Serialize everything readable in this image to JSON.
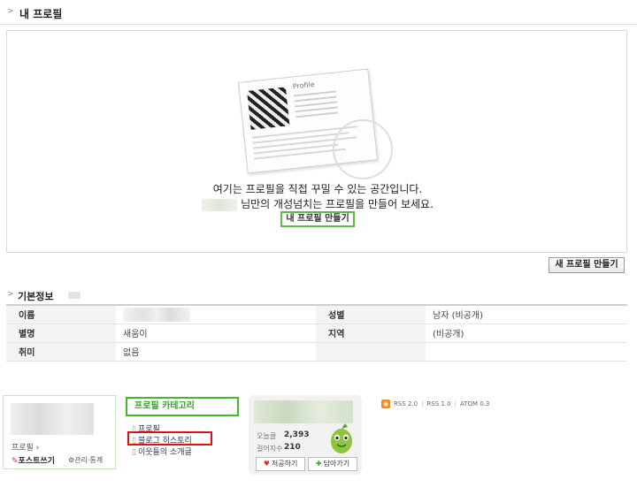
{
  "header": {
    "title": "내 프로필"
  },
  "profile_area": {
    "card_title": "Profile",
    "message_line1": "여기는 프로필을 직접 꾸밀 수 있는 공간입니다.",
    "message_line2": "님만의 개성넘치는 프로필을 만들어 보세요.",
    "make_button": "내 프로필 만들기"
  },
  "new_profile_button": "새 프로필 만들기",
  "basic_info": {
    "title": "기본정보",
    "rows": [
      {
        "label1": "이름",
        "value1": "",
        "label2": "성별",
        "value2": "남자 (비공개)"
      },
      {
        "label1": "별명",
        "value1": "새움이",
        "label2": "지역",
        "value2": "(비공개)"
      },
      {
        "label1": "취미",
        "value1": "없음",
        "label2": "",
        "value2": ""
      }
    ]
  },
  "widget_profile": {
    "label": "프로필 ›",
    "write_post": "포스트쓰기",
    "manage": "관리·통계"
  },
  "widget_category": {
    "title": "프로필 카테고리",
    "items": [
      "프로필",
      "블로그 히스토리",
      "이웃들의 소개글"
    ]
  },
  "widget_stats": {
    "visitors_label": "오늘클",
    "visitors_value": "2,393",
    "neighbors_label": "걸어지수",
    "neighbors_value": "210",
    "like_button": "저공하기",
    "add_button": "담아가기"
  },
  "rss": {
    "items": [
      "RSS 2.0",
      "RSS 1.0",
      "ATOM 0.3"
    ]
  },
  "colors": {
    "accent_green": "#44b82a",
    "highlight_red": "#e01010",
    "rss_orange": "#f08a1c"
  }
}
